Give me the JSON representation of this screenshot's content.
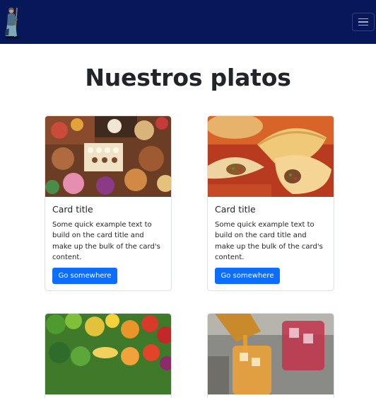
{
  "navbar": {
    "logo_icon": "figure-with-staff-icon",
    "toggler_icon": "hamburger-menu-icon"
  },
  "main": {
    "title": "Nuestros platos"
  },
  "cards": [
    {
      "image": "snacks-table-photo",
      "title": "Card title",
      "text": "Some quick example text to build on the card title and make up the bulk of the card's content.",
      "button": "Go somewhere"
    },
    {
      "image": "empanadas-photo",
      "title": "Card title",
      "text": "Some quick example text to build on the card title and make up the bulk of the card's content.",
      "button": "Go somewhere"
    },
    {
      "image": "vegetables-fruits-photo"
    },
    {
      "image": "drinks-photo"
    }
  ],
  "colors": {
    "navbar_bg": "#06175a",
    "button_bg": "#0d6efd"
  }
}
